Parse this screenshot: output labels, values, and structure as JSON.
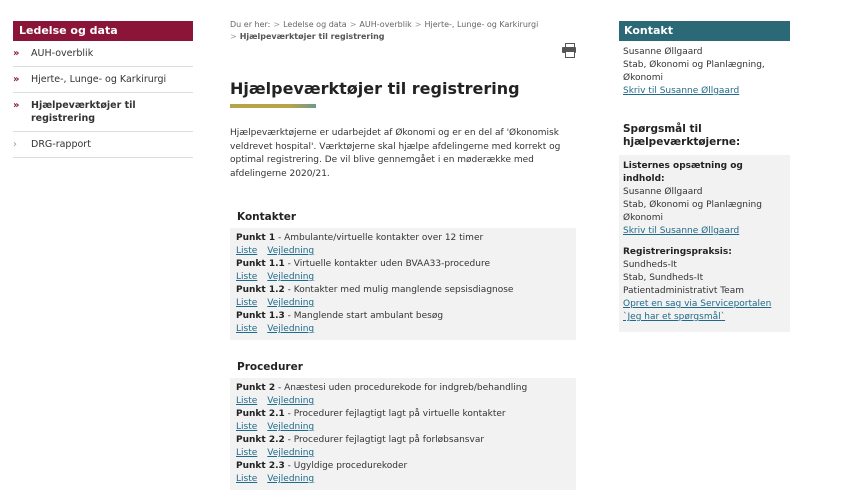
{
  "sidebar": {
    "heading": "Ledelse og data",
    "items": [
      {
        "label": "AUH-overblik"
      },
      {
        "label": "Hjerte-, Lunge- og Karkirurgi"
      },
      {
        "label": "Hjælpeværktøjer til registrering"
      },
      {
        "label": "DRG-rapport"
      }
    ]
  },
  "breadcrumb": {
    "prefix": "Du er her:",
    "items": [
      "Ledelse og data",
      "AUH-overblik",
      "Hjerte-, Lunge- og Karkirurgi"
    ],
    "current": "Hjælpeværktøjer til registrering"
  },
  "page": {
    "title": "Hjælpeværktøjer til registrering",
    "intro": "Hjælpeværktøjerne er udarbejdet af Økonomi og er en del af 'Økonomisk veldrevet hospital'. Værktøjerne skal hjælpe afdelingerne med korrekt og optimal registrering. De vil blive gennemgået i en møderække med afdelingerne 2020/21."
  },
  "sections": {
    "kontakter": {
      "heading": "Kontakter",
      "points": [
        {
          "label": "Punkt 1",
          "desc": " - Ambulante/virtuelle kontakter over 12 timer",
          "link1": "Liste",
          "link2": "Vejledning"
        },
        {
          "label": "Punkt 1.1",
          "desc": " - Virtuelle kontakter uden BVAA33-procedure",
          "link1": "Liste",
          "link2": "Vejledning"
        },
        {
          "label": "Punkt 1.2",
          "desc": " - Kontakter med mulig manglende sepsisdiagnose",
          "link1": "Liste",
          "link2": "Vejledning"
        },
        {
          "label": "Punkt 1.3",
          "desc": " - Manglende start ambulant besøg",
          "link1": "Liste",
          "link2": "Vejledning"
        }
      ]
    },
    "procedurer": {
      "heading": "Procedurer",
      "points": [
        {
          "label": "Punkt 2",
          "desc": " - Anæstesi uden procedurekode for indgreb/behandling",
          "link1": "Liste",
          "link2": "Vejledning"
        },
        {
          "label": "Punkt 2.1",
          "desc": " - Procedurer fejlagtigt lagt på virtuelle kontakter",
          "link1": "Liste",
          "link2": "Vejledning"
        },
        {
          "label": "Punkt 2.2",
          "desc": " - Procedurer fejlagtigt lagt på forløbsansvar",
          "link1": "Liste",
          "link2": "Vejledning"
        },
        {
          "label": "Punkt 2.3",
          "desc": " - Ugyldige procedurekoder",
          "link1": "Liste",
          "link2": "Vejledning"
        }
      ]
    }
  },
  "contact": {
    "heading": "Kontakt",
    "name": "Susanne Øllgaard",
    "dept": "Stab, Økonomi og Planlægning,",
    "dept2": "Økonomi",
    "link": "Skriv til Susanne Øllgaard"
  },
  "questions": {
    "title": "Spørgsmål til hjælpeværktøjerne:",
    "block1": {
      "heading": "Listernes opsætning og indhold:",
      "name": "Susanne Øllgaard",
      "dept": "Stab, Økonomi og Planlægning",
      "dept2": "Økonomi",
      "link": "Skriv til Susanne Øllgaard"
    },
    "block2": {
      "heading": "Registreringspraksis:",
      "line1": "Sundheds-It",
      "line2": "Stab, Sundheds-It",
      "line3": "Patientadministrativt Team",
      "link1": "Opret en sag via Serviceportalen",
      "link2": "`Jeg har et spørgsmål`"
    }
  },
  "colors": {
    "sidebar_head": "#8a1538",
    "contact_head": "#2b6977",
    "link": "#1f6a8a"
  }
}
